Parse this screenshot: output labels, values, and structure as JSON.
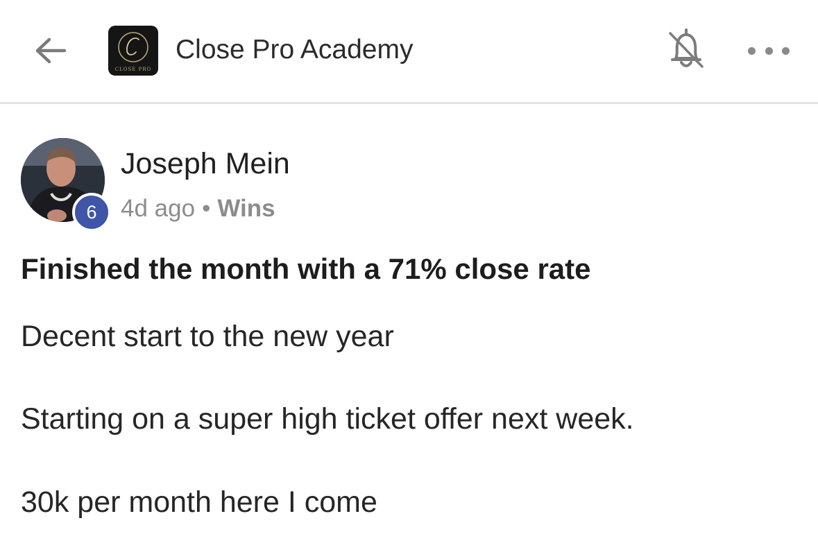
{
  "header": {
    "group_name": "Close Pro Academy",
    "logo_text": "CLOSE PRO",
    "icons": {
      "back": "arrow-left-icon",
      "logo": "close-pro-logo",
      "notifications": "bell-off-icon",
      "more": "more-horizontal-icon"
    }
  },
  "post": {
    "author": {
      "name": "Joseph Mein",
      "level": "6"
    },
    "time_ago": "4d ago",
    "separator": "•",
    "category": "Wins",
    "title": "Finished the month with a 71% close rate",
    "body_lines": [
      "Decent start to the new year",
      "Starting on a super high ticket offer next week.",
      "30k per month here I come"
    ]
  },
  "colors": {
    "badge": "#3e55a8",
    "muted_text": "#8c8c8c",
    "divider": "#e3e3e3",
    "logo_gold": "#b9a778"
  }
}
